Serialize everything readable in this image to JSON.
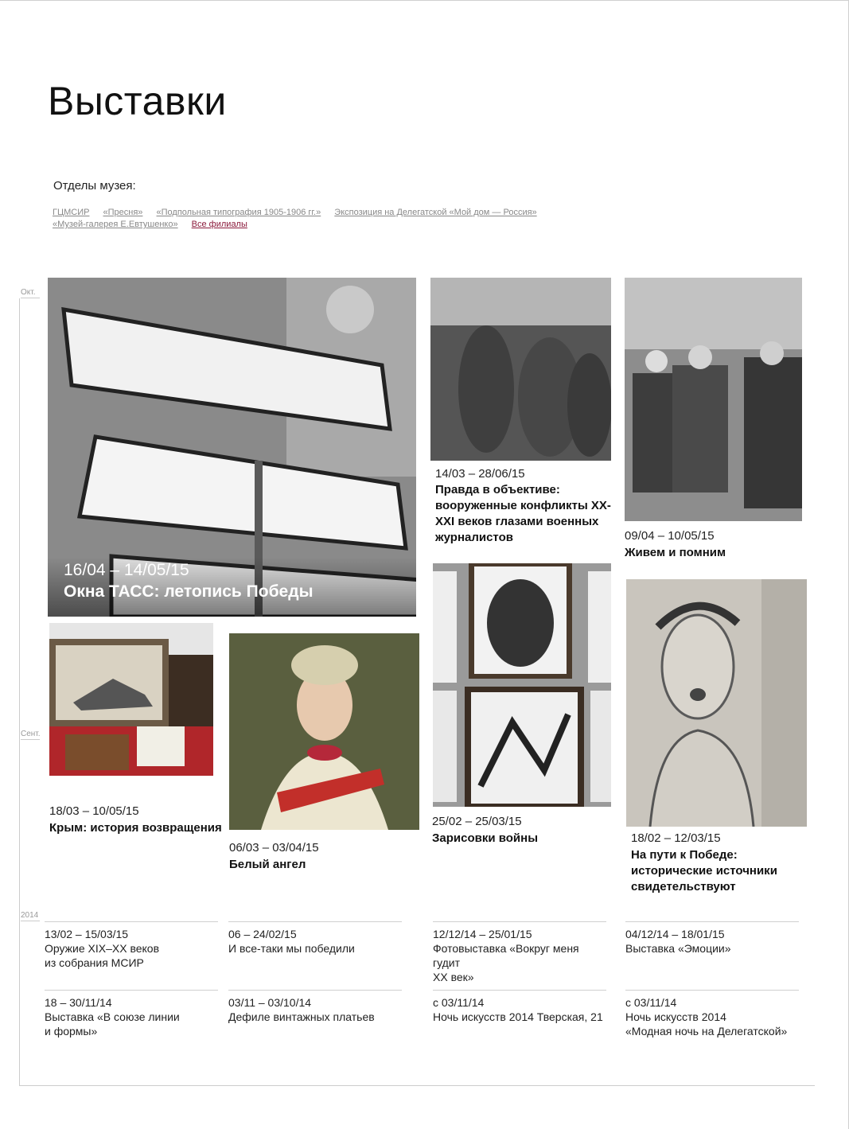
{
  "page": {
    "title": "Выставки"
  },
  "departments": {
    "label": "Отделы музея:",
    "links": [
      "ГЦМСИР",
      "«Пресня»",
      "«Подпольная типография 1905-1906 гг.»",
      "Экспозиция на Делегатской «Мой дом — Россия»",
      "«Музей-галерея Е.Евтушенко»"
    ],
    "all_link": "Все филиалы"
  },
  "timeline": {
    "marks": [
      "Окт.",
      "Сент.",
      "2014"
    ]
  },
  "featured": {
    "hero": {
      "date": "16/04 – 14/05/15",
      "title": "Окна ТАСС: летопись Победы",
      "image": "berlin-signs-photo"
    },
    "cards": [
      {
        "date": "14/03 – 28/06/15",
        "title": "Правда в объективе: вооруженные конфликты XX-XXI веков глазами военных журналистов",
        "image": "soldiers-photo"
      },
      {
        "date": "09/04 – 10/05/15",
        "title": "Живем и помним",
        "image": "veterans-audience-photo"
      },
      {
        "date": "18/03 – 10/05/15",
        "title": "Крым: история возвращения",
        "image": "crimea-exhibit-photo"
      },
      {
        "date": "06/03 – 03/04/15",
        "title": "Белый ангел",
        "image": "portrait-painting"
      },
      {
        "date": "25/02 – 25/03/15",
        "title": "Зарисовки войны",
        "image": "war-sketches-photo"
      },
      {
        "date": "18/02 – 12/03/15",
        "title": "На пути к Победе: исторические источники свидетельствуют",
        "image": "sketch-drawing-photo"
      }
    ]
  },
  "archive": [
    {
      "date": "13/02 – 15/03/15",
      "title": "Оружие XIX–XX веков\nиз собрания МСИР"
    },
    {
      "date": "06 – 24/02/15",
      "title": "И все-таки мы победили"
    },
    {
      "date": "12/12/14 – 25/01/15",
      "title": "Фотовыставка «Вокруг меня гудит\nXX век»"
    },
    {
      "date": "04/12/14 – 18/01/15",
      "title": "Выставка «Эмоции»"
    },
    {
      "date": "18 – 30/11/14",
      "title": "Выставка «В союзе линии\nи формы»"
    },
    {
      "date": "03/11 – 03/10/14",
      "title": "Дефиле винтажных платьев"
    },
    {
      "date": "с 03/11/14",
      "title": "Ночь искусств 2014 Тверская, 21"
    },
    {
      "date": "с 03/11/14",
      "title": "Ночь искусств 2014\n«Модная ночь на Делегатской»"
    }
  ],
  "colors": {
    "accent": "#8b1a3b",
    "muted_link": "#888888",
    "line": "#cccccc"
  }
}
